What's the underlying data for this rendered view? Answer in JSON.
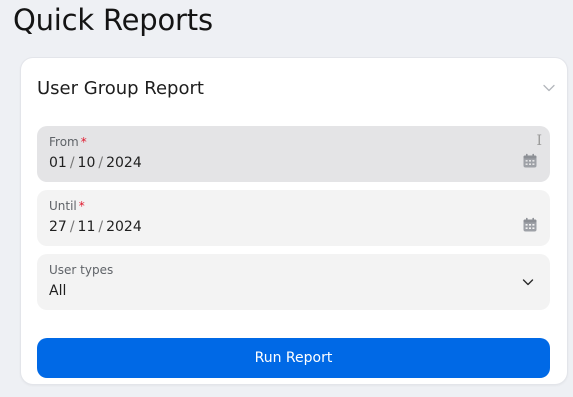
{
  "page": {
    "title": "Quick Reports"
  },
  "report": {
    "title": "User Group Report",
    "from": {
      "label": "From",
      "required_mark": "*",
      "day": "01",
      "month": "10",
      "year": "2024",
      "separator": "/"
    },
    "until": {
      "label": "Until",
      "required_mark": "*",
      "day": "27",
      "month": "11",
      "year": "2024",
      "separator": "/"
    },
    "user_types": {
      "label": "User types",
      "selected": "All"
    },
    "run_button_label": "Run Report"
  },
  "icons": {
    "collapse": "chevron-down-icon",
    "from_calendar": "calendar-icon",
    "until_calendar": "calendar-icon",
    "user_types_dropdown": "chevron-down-icon",
    "text_cursor": "text-cursor-icon"
  },
  "colors": {
    "background": "#eef0f4",
    "card": "#ffffff",
    "field": "#f3f3f3",
    "field_active": "#e4e4e6",
    "accent": "#0069e6",
    "required": "#e0182d"
  }
}
